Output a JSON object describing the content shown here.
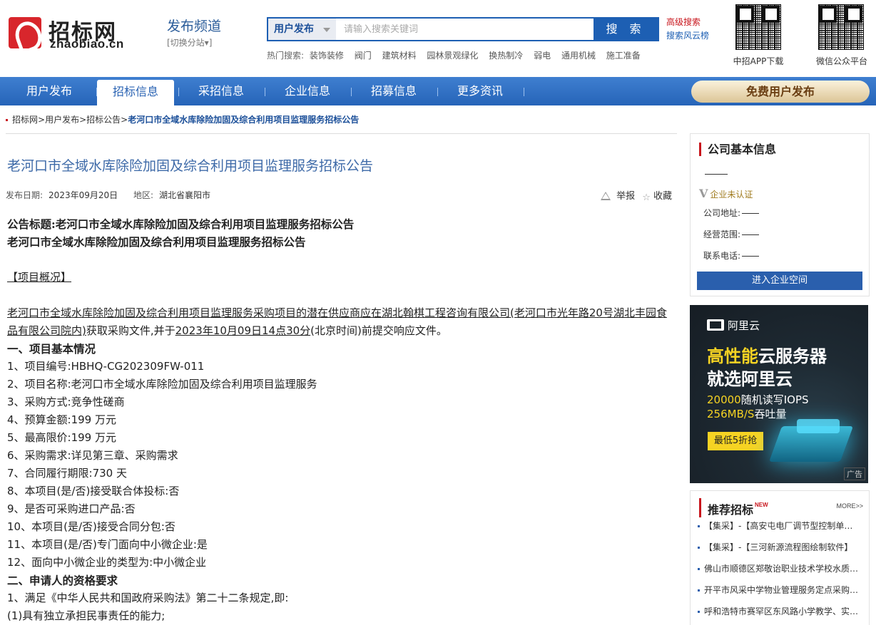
{
  "header": {
    "logo_cn": "招标网",
    "logo_en": "zhaobiao.cn",
    "channel_title": "发布频道",
    "channel_switch": "[切换分站▾]",
    "search": {
      "category": "用户发布",
      "placeholder": "请输入搜索关键词",
      "button": "搜 索",
      "advanced": "高级搜索",
      "cloud": "搜索风云榜"
    },
    "hot": {
      "label": "热门搜索:",
      "items": [
        "装饰装修",
        "阀门",
        "建筑材料",
        "园林景观绿化",
        "换热制冷",
        "弱电",
        "通用机械",
        "施工准备"
      ]
    },
    "qr1_label": "中招APP下载",
    "qr2_label": "微信公众平台"
  },
  "nav": {
    "items": [
      "用户发布",
      "招标信息",
      "采招信息",
      "企业信息",
      "招募信息",
      "更多资讯"
    ],
    "active_index": 1,
    "cta": "免费用户发布"
  },
  "breadcrumb": {
    "items": [
      "招标网",
      "用户发布",
      "招标公告"
    ],
    "current": "老河口市全域水库除险加固及综合利用项目监理服务招标公告"
  },
  "article": {
    "title": "老河口市全域水库除险加固及综合利用项目监理服务招标公告",
    "date_label": "发布日期:",
    "date": "2023年09月20日",
    "region_label": "地区:",
    "region": "湖北省襄阳市",
    "report": "举报",
    "favorite": "收藏",
    "heading1": "公告标题:老河口市全域水库除险加固及综合利用项目监理服务招标公告",
    "heading2": "老河口市全域水库除险加固及综合利用项目监理服务招标公告",
    "overview": "【项目概况】",
    "intro_a": "老河口市全域水库除险加固及综合利用项目监理服务采购项目的潜在供应商应在湖北翰棋工程咨询有限公司(老河口市光年路20号湖北丰园食品有限公司院内)",
    "intro_b": "获取采购文件,并于",
    "intro_c": "2023年10月09日14点30分",
    "intro_d": "(北京时间)前提交响应文件。",
    "section1": "一、项目基本情况",
    "lines1": [
      "1、项目编号:HBHQ-CG202309FW-011",
      "2、项目名称:老河口市全域水库除险加固及综合利用项目监理服务",
      "3、采购方式:竞争性磋商",
      "4、预算金额:199 万元",
      "5、最高限价:199 万元",
      "6、采购需求:详见第三章、采购需求",
      "7、合同履行期限:730 天",
      "8、本项目(是/否)接受联合体投标:否",
      "9、是否可采购进口产品:否",
      "10、本项目(是/否)接受合同分包:否",
      "11、本项目(是/否)专门面向中小微企业:是",
      "12、面向中小微企业的类型为:中小微企业"
    ],
    "section2": "二、申请人的资格要求",
    "lines2": [
      "1、满足《中华人民共和国政府采购法》第二十二条规定,即:",
      "(1)具有独立承担民事责任的能力;"
    ]
  },
  "company": {
    "title": "公司基本信息",
    "verify": "企业未认证",
    "address_label": "公司地址:",
    "scope_label": "经营范围:",
    "phone_label": "联系电话:",
    "button": "进入企业空间"
  },
  "ad": {
    "brand": "阿里云",
    "headline_hl": "高性能",
    "headline_rest": "云服务器",
    "headline2": "就选阿里云",
    "sub1_num": "20000",
    "sub1_text": "随机读写IOPS",
    "sub2_num": "256MB/S",
    "sub2_text": "吞吐量",
    "cta": "最低5折抢",
    "tag": "广告"
  },
  "recommend": {
    "title": "推荐招标",
    "new": "NEW",
    "more": "MORE>>",
    "items": [
      "【集采】-【高安屯电厂调节型控制单元】",
      "【集采】-【三河新源流程图绘制软件】",
      "佛山市顺德区郑敬诒职业技术学校水质检测",
      "开平市风采中学物业管理服务定点采购项目",
      "呼和浩特市赛罕区东风路小学教学、实验设备"
    ]
  },
  "colors": {
    "brand_red": "#c8161d",
    "nav_blue": "#2a6bc2",
    "link_blue": "#1b4f99"
  }
}
